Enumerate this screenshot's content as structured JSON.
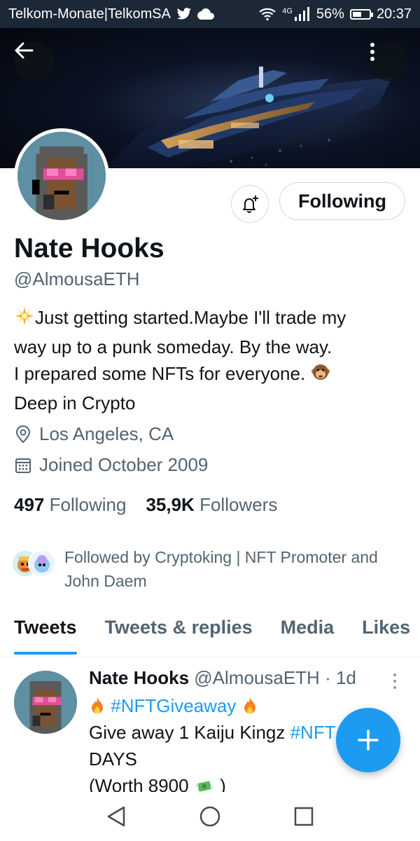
{
  "status_bar": {
    "carrier": "Telkom-Monate|TelkomSA",
    "network": "4G",
    "battery": "56%",
    "battery_level": 0.56,
    "time": "20:37",
    "icons": [
      "twitter-bird-icon",
      "cloud-icon",
      "wifi-icon",
      "signal-icon",
      "battery-icon"
    ]
  },
  "profile": {
    "name": "Nate Hooks",
    "handle": "@AlmousaETH",
    "bio_line1": "Just getting started.Maybe I'll trade my",
    "bio_line2": "way up to a punk someday. By the way.",
    "bio_line3": "I prepared some NFTs for everyone.",
    "bio_line4": "Deep in Crypto",
    "location": "Los Angeles, CA",
    "joined": "Joined October 2009",
    "following_count": "497",
    "following_label": "Following",
    "followers_count": "35,9K",
    "followers_label": "Followers",
    "followed_by_line1": "Followed by Cryptoking | NFT Promoter and",
    "followed_by_line2": "John Daem"
  },
  "actions": {
    "follow_button": "Following"
  },
  "tabs": [
    {
      "label": "Tweets",
      "active": true
    },
    {
      "label": "Tweets & replies",
      "active": false
    },
    {
      "label": "Media",
      "active": false
    },
    {
      "label": "Likes",
      "active": false
    }
  ],
  "tweet": {
    "name": "Nate Hooks",
    "handle": "@AlmousaETH",
    "time": "· 1d",
    "hashtag1": "#NFTGiveaway",
    "line2_text": "Give away 1 Kaiju Kingz ",
    "line2_hashtag": "#NFT",
    "line3": "DAYS",
    "line4": "(Worth 8900",
    "line4_end": ")"
  },
  "colors": {
    "accent": "#1d9bf0",
    "text_primary": "#0f1419",
    "text_secondary": "#536471",
    "status_bar": "#1c2836"
  }
}
